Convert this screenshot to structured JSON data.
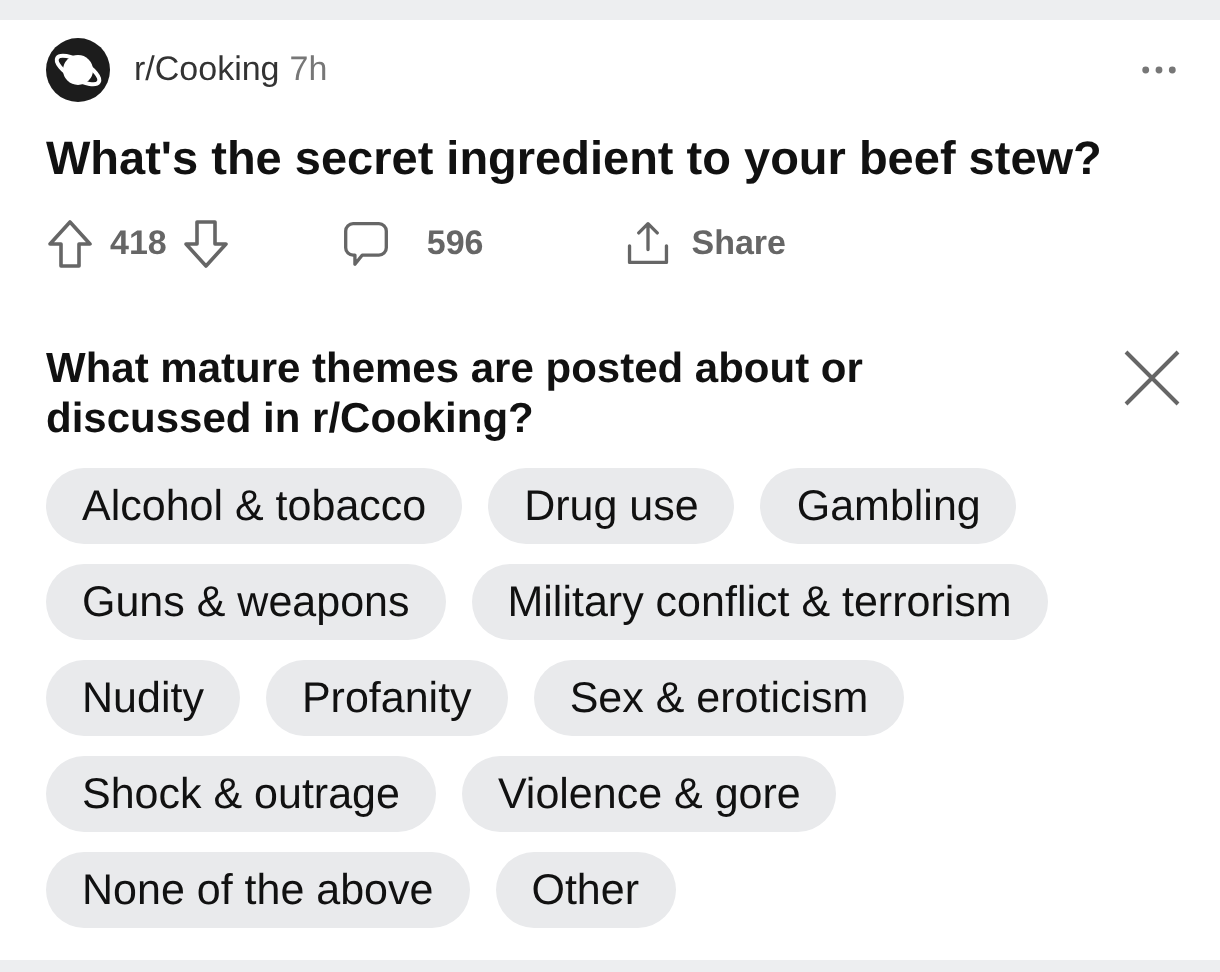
{
  "post": {
    "community": "r/Cooking",
    "age": "7h",
    "title": "What's the secret ingredient to your beef stew?",
    "votes": "418",
    "comments": "596",
    "share": "Share"
  },
  "survey": {
    "question": "What mature themes are posted about or discussed in r/Cooking?",
    "options": [
      "Alcohol & tobacco",
      "Drug use",
      "Gambling",
      "Guns & weapons",
      "Military conflict & terrorism",
      "Nudity",
      "Profanity",
      "Sex & eroticism",
      "Shock & outrage",
      "Violence & gore",
      "None of the above",
      "Other"
    ]
  }
}
